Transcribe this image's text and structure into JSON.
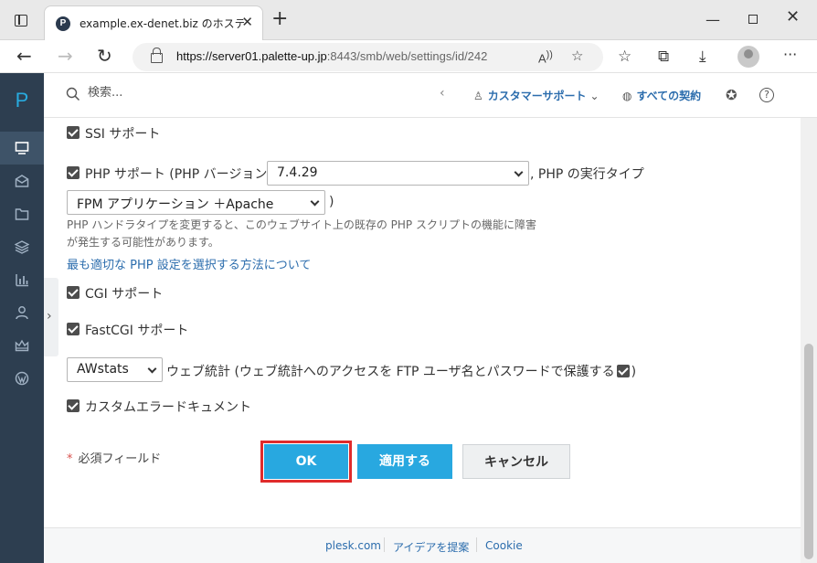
{
  "browser": {
    "tab_title": "example.ex-denet.biz のホスティング",
    "tab_favicon": "P",
    "url_host": "https://server01.palette-up.jp",
    "url_path": ":8443/smb/web/settings/id/242",
    "icons": [
      "tab-actions-icon",
      "back-icon",
      "forward-icon",
      "reload-icon",
      "lock-icon",
      "read-aloud-icon",
      "add-favorite-icon",
      "favorites-icon",
      "collections-icon",
      "downloads-icon",
      "profile-icon",
      "more-icon"
    ]
  },
  "sidebar": {
    "logo": "P",
    "items": [
      "websites-icon",
      "mail-icon",
      "files-icon",
      "databases-icon",
      "statistics-icon",
      "users-icon",
      "account-icon",
      "wordpress-icon"
    ]
  },
  "topbar": {
    "search_placeholder": "検索...",
    "support_label": "カスタマーサポート",
    "subscriptions_label": "すべての契約"
  },
  "form": {
    "ssi_label": "SSI サポート",
    "php_label": "PHP サポート (PHP バージョン",
    "php_version": "7.4.29",
    "php_run_type_label": ", PHP の実行タイプ",
    "php_handler": "FPM アプリケーション ＋Apache",
    "php_handler_close": ")",
    "php_note": "PHP ハンドラタイプを変更すると、このウェブサイト上の既存の PHP スクリプトの機能に障害が発生する可能性があります。",
    "php_link": "最も適切な PHP 設定を選択する方法について",
    "cgi_label": "CGI サポート",
    "fastcgi_label": "FastCGI サポート",
    "stats_select": "AWstats",
    "stats_label": "ウェブ統計 (ウェブ統計へのアクセスを FTP ユーザ名とパスワードで保護する",
    "stats_close": ")",
    "error_docs_label": "カスタムエラードキュメント",
    "required_star": "*",
    "required_label": "必須フィールド",
    "ok_button": "OK",
    "apply_button": "適用する",
    "cancel_button": "キャンセル"
  },
  "footer": {
    "links": [
      "plesk.com",
      "アイデアを提案",
      "Cookie"
    ]
  },
  "colors": {
    "sidebar_bg": "#2d3e50",
    "primary_button": "#28a8e0",
    "highlight_border": "#e02b2b",
    "link": "#2c6dad"
  }
}
